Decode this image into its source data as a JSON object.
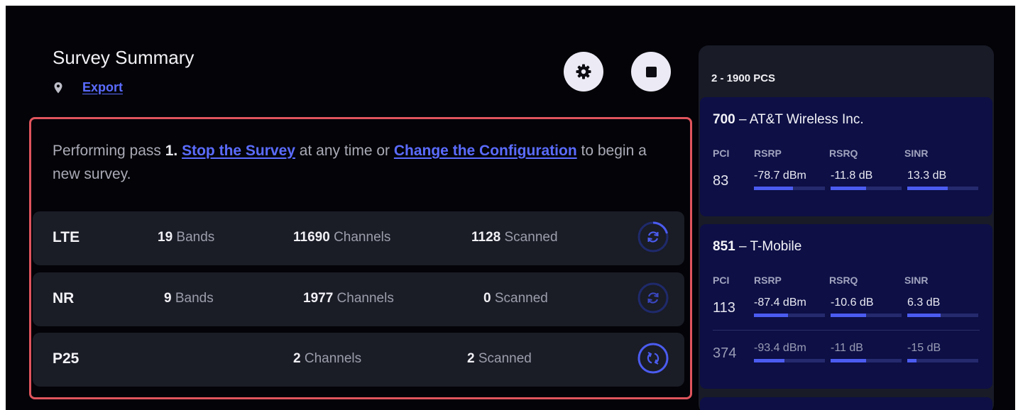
{
  "survey": {
    "title": "Survey Summary",
    "export_label": "Export",
    "message": {
      "prefix": "Performing pass ",
      "pass": "1.",
      "stop_link": "Stop the Survey",
      "middle": " at any time or ",
      "config_link": "Change the Configuration",
      "suffix": " to begin a new survey."
    },
    "rows": [
      {
        "name": "LTE",
        "bands": "19",
        "bands_label": " Bands",
        "channels": "11690",
        "channels_label": " Channels",
        "scanned": "1128",
        "scanned_label": " Scanned"
      },
      {
        "name": "NR",
        "bands": "9",
        "bands_label": " Bands",
        "channels": "1977",
        "channels_label": " Channels",
        "scanned": "0",
        "scanned_label": " Scanned"
      },
      {
        "name": "P25",
        "channels": "2",
        "channels_label": " Channels",
        "scanned": "2",
        "scanned_label": " Scanned"
      }
    ]
  },
  "panel": {
    "band_title": "2 - 1900 PCS",
    "headers": {
      "pci": "PCI",
      "rsrp": "RSRP",
      "rsrq": "RSRQ",
      "sinr": "SINR"
    },
    "cards": [
      {
        "channel": "700",
        "operator": " – AT&T Wireless Inc.",
        "cells": [
          {
            "pci": "83",
            "rsrp": "-78.7 dBm",
            "rsrq": "-11.8 dB",
            "sinr": "13.3 dB",
            "rsrp_level": 0.55,
            "rsrq_level": 0.5,
            "sinr_level": 0.57
          }
        ]
      },
      {
        "channel": "851",
        "operator": " – T-Mobile",
        "cells": [
          {
            "pci": "113",
            "rsrp": "-87.4 dBm",
            "rsrq": "-10.6 dB",
            "sinr": "6.3 dB",
            "rsrp_level": 0.48,
            "rsrq_level": 0.5,
            "sinr_level": 0.47
          },
          {
            "pci": "374",
            "rsrp": "-93.4 dBm",
            "rsrq": "-11 dB",
            "sinr": "-15 dB",
            "rsrp_level": 0.43,
            "rsrq_level": 0.5,
            "sinr_level": 0.13
          }
        ]
      }
    ]
  },
  "colors": {
    "accent": "#5b6cff",
    "highlight": "#e0545c",
    "card_bg": "#0d0f45",
    "row_bg": "#1a1c26"
  }
}
